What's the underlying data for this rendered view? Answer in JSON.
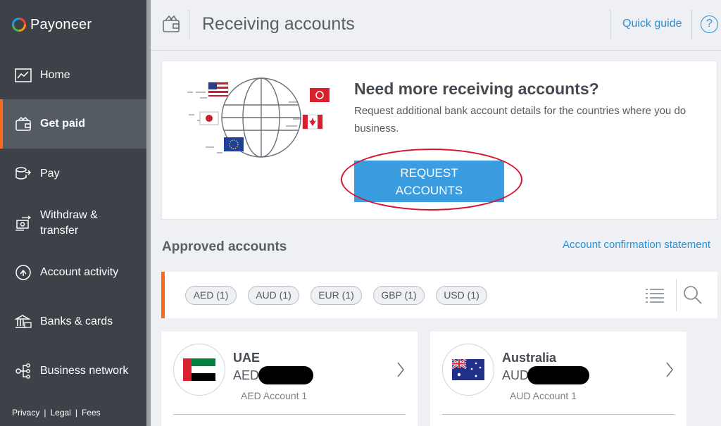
{
  "brand": {
    "name": "Payoneer"
  },
  "sidebar": {
    "items": [
      {
        "label": "Home",
        "icon": "chart-icon"
      },
      {
        "label": "Get paid",
        "icon": "wallet-icon",
        "active": true
      },
      {
        "label": "Pay",
        "icon": "pay-icon"
      },
      {
        "label": "Withdraw &",
        "label2": "transfer",
        "icon": "withdraw-icon"
      },
      {
        "label": "Account activity",
        "icon": "activity-icon"
      },
      {
        "label": "Banks & cards",
        "icon": "bank-icon"
      },
      {
        "label": "Business network",
        "icon": "network-icon"
      }
    ],
    "footer": {
      "privacy": "Privacy",
      "legal": "Legal",
      "fees": "Fees",
      "separator": "|"
    }
  },
  "header": {
    "title": "Receiving accounts",
    "quick_guide": "Quick guide",
    "help": "?"
  },
  "promo": {
    "title": "Need more receiving accounts?",
    "description": "Request additional bank account details for the countries where you do business.",
    "button_line1": "REQUEST",
    "button_line2": "ACCOUNTS"
  },
  "approved": {
    "title": "Approved accounts",
    "confirmation_link": "Account confirmation statement",
    "chips": [
      "AED (1)",
      "AUD (1)",
      "EUR (1)",
      "GBP (1)",
      "USD (1)"
    ]
  },
  "accounts": [
    {
      "country": "UAE",
      "currency": "AED",
      "subtitle": "AED Account 1",
      "flag": "uae-flag-icon"
    },
    {
      "country": "Australia",
      "currency": "AUD",
      "subtitle": "AUD Account 1",
      "flag": "australia-flag-icon"
    }
  ],
  "colors": {
    "sidebar_bg": "#3d4249",
    "accent_orange": "#ff6a1a",
    "link_blue": "#2c8fd4",
    "button_blue": "#3a9de0",
    "annotation_red": "#d8142a"
  }
}
